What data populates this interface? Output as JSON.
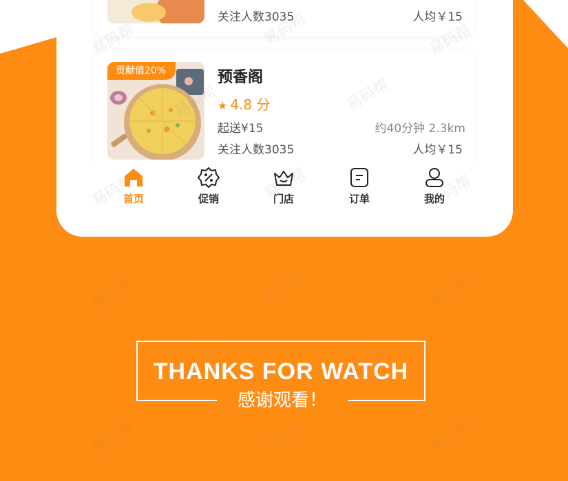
{
  "stores": [
    {
      "followers": "关注人数3035",
      "per_person": "人均￥15"
    },
    {
      "badge": "贡献值20%",
      "name": "预香阁",
      "rating": "4.8 分",
      "min_order": "起送¥15",
      "delivery": "约40分钟 2.3km",
      "followers": "关注人数3035",
      "per_person": "人均￥15"
    }
  ],
  "tabs": [
    {
      "label": "首页",
      "icon": "home-icon",
      "active": true
    },
    {
      "label": "促销",
      "icon": "promo-badge-icon",
      "active": false
    },
    {
      "label": "门店",
      "icon": "crown-basket-icon",
      "active": false
    },
    {
      "label": "订单",
      "icon": "order-doc-icon",
      "active": false
    },
    {
      "label": "我的",
      "icon": "user-icon",
      "active": false
    }
  ],
  "thanks": {
    "title": "THANKS FOR WATCH",
    "subtitle": "感谢观看！"
  },
  "watermark_text": "易码帮",
  "colors": {
    "accent": "#ff8c12",
    "card": "#ffffff",
    "text_dark": "#222222",
    "text_muted": "#888888"
  }
}
